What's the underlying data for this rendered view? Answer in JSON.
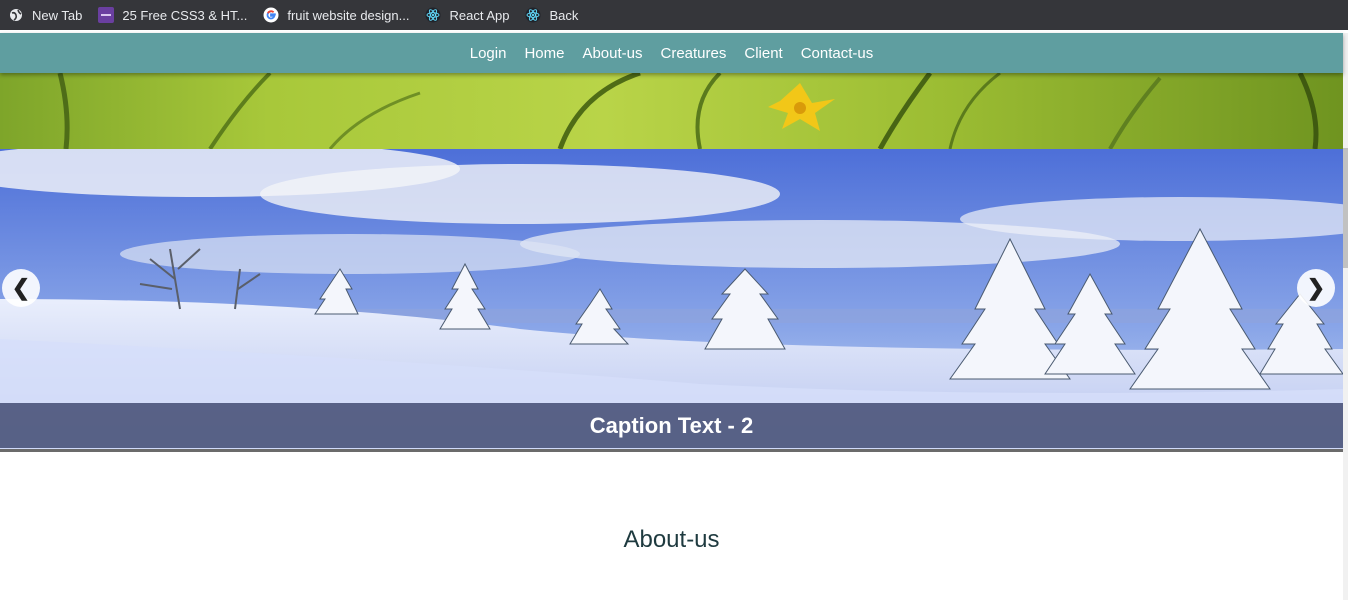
{
  "bookmarks": [
    {
      "label": "New Tab",
      "icon": "globe-icon"
    },
    {
      "label": "25 Free CSS3 & HT...",
      "icon": "colorlib-icon"
    },
    {
      "label": "fruit website design...",
      "icon": "google-icon"
    },
    {
      "label": "React App",
      "icon": "react-icon"
    },
    {
      "label": "Back",
      "icon": "react-icon"
    }
  ],
  "nav": {
    "items": [
      "Login",
      "Home",
      "About-us",
      "Creatures",
      "Client",
      "Contact-us"
    ],
    "color": "#5f9ea0"
  },
  "slideshow": {
    "caption": "Caption Text - 2",
    "prev_symbol": "❮",
    "next_symbol": "❯"
  },
  "about": {
    "title": "About-us"
  }
}
